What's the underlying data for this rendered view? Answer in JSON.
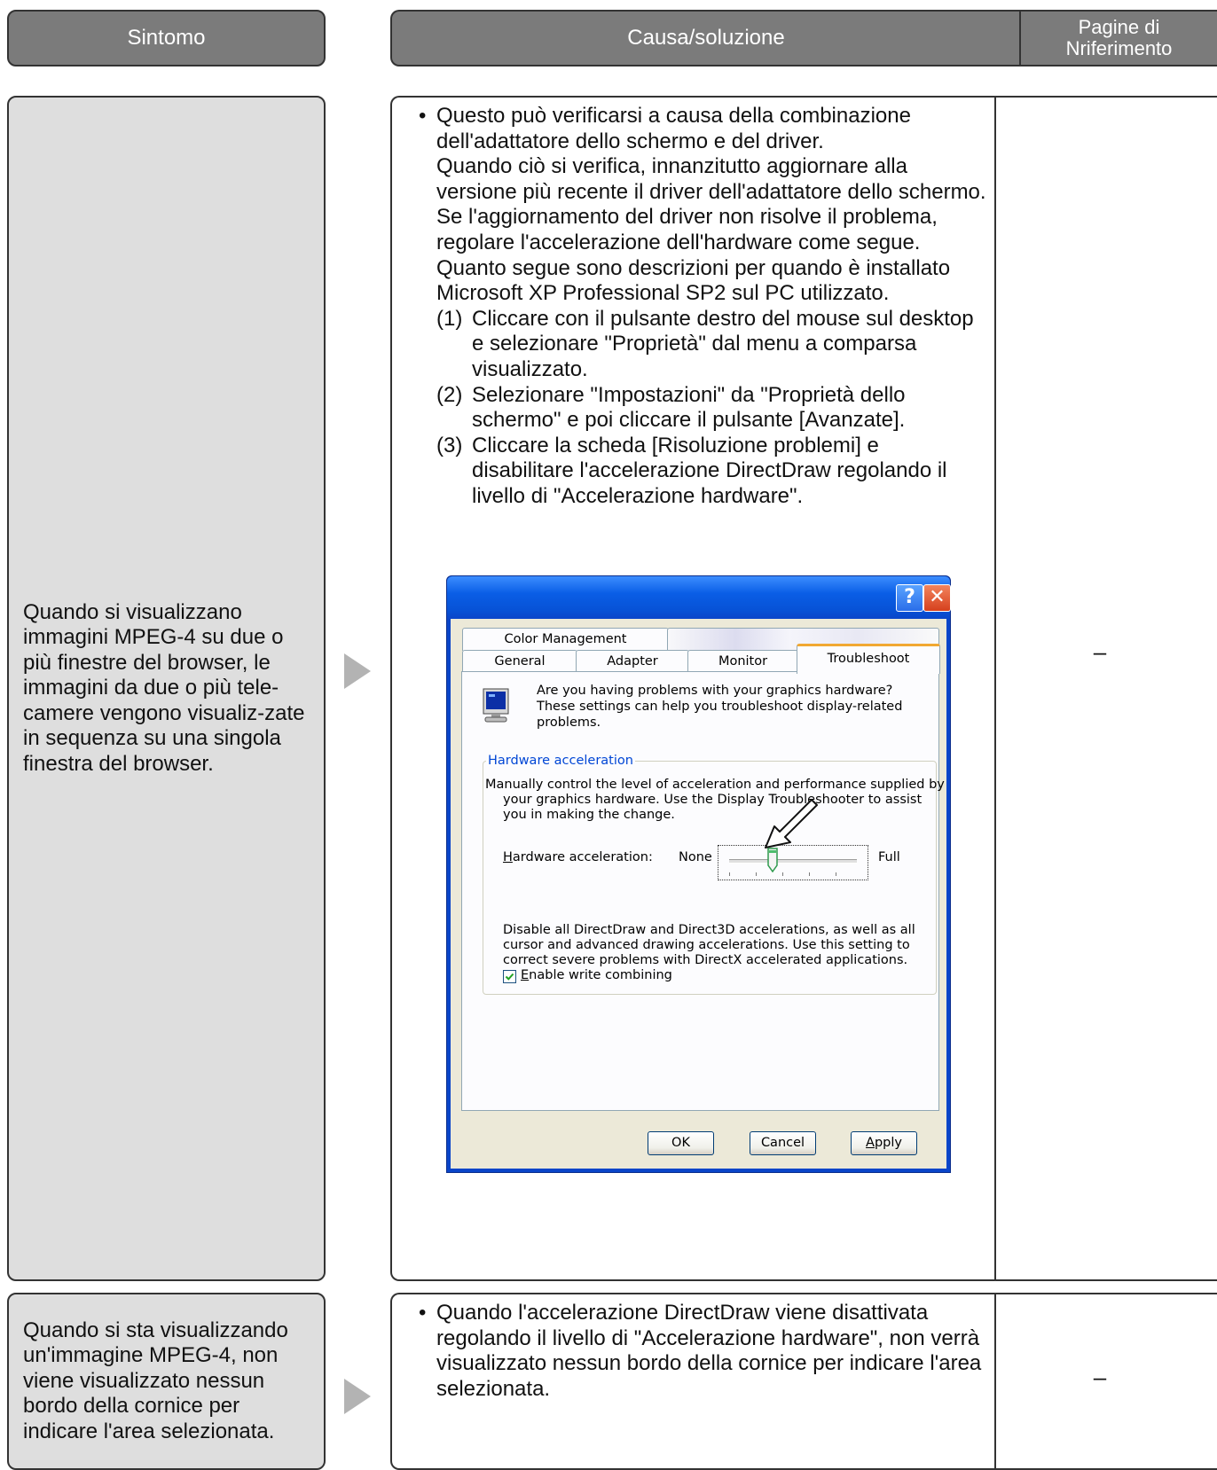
{
  "headers": {
    "symptom": "Sintomo",
    "cause": "Causa/soluzione",
    "ref_line1": "Pagine di",
    "ref_line2": "Nriferimento"
  },
  "row1": {
    "symptom": "Quando si visualizzano immagini MPEG-4 su due o più finestre del browser, le immagini da due o più tele-camere vengono visualiz-zate in sequenza su una singola finestra del browser.",
    "bullet": "•",
    "p1": "Questo può verificarsi a causa della combinazione dell'adattatore dello schermo e del driver.",
    "p2": "Quando ciò si verifica, innanzitutto aggiornare alla versione più recente il driver dell'adattatore dello schermo.",
    "p3": "Se l'aggiornamento del driver non risolve il problema, regolare l'accelerazione dell'hardware come segue.",
    "p4": "Quanto segue sono descrizioni per quando è installato Microsoft XP Professional SP2 sul PC utilizzato.",
    "steps": [
      {
        "num": "(1)",
        "text": "Cliccare con il pulsante destro del mouse sul desktop e selezionare \"Proprietà\" dal menu a comparsa visualizzato."
      },
      {
        "num": "(2)",
        "text": "Selezionare \"Impostazioni\" da \"Proprietà dello schermo\" e poi cliccare il pulsante [Avanzate]."
      },
      {
        "num": "(3)",
        "text": "Cliccare la scheda [Risoluzione problemi] e disabilitare l'accelerazione DirectDraw regolando il livello di \"Accelerazione hardware\"."
      }
    ],
    "ref": "–"
  },
  "dialog": {
    "help_glyph": "?",
    "close_glyph": "✕",
    "tabs_top": [
      "Color Management"
    ],
    "tabs_bottom": [
      "General",
      "Adapter",
      "Monitor",
      "Troubleshoot"
    ],
    "intro": "Are you having problems with your graphics hardware? These settings can help you troubleshoot display-related problems.",
    "group_title": "Hardware acceleration",
    "group_desc": "Manually control the level of acceleration and performance supplied by your graphics hardware. Use the Display Troubleshooter to assist you in making the change.",
    "slider_label_first": "H",
    "slider_label_rest": "ardware acceleration:",
    "slider_min": "None",
    "slider_max": "Full",
    "slider_level_fraction": 0.34,
    "level_desc": "Disable all DirectDraw and Direct3D accelerations, as well as all cursor and advanced drawing accelerations. Use this setting to correct severe problems with DirectX accelerated applications.",
    "checkbox_first": "E",
    "checkbox_rest": "nable write combining",
    "checkbox_checked": true,
    "buttons": {
      "ok": "OK",
      "cancel": "Cancel",
      "apply_first": "A",
      "apply_rest": "pply"
    },
    "colors": {
      "titlebar": "#0a5ee6",
      "client": "#ece9d8",
      "active_tab_accent": "#f1a832",
      "close": "#d6401d"
    }
  },
  "row2": {
    "symptom": "Quando si sta visualizzando un'immagine MPEG-4, non viene visualizzato nessun bordo della cornice per indicare l'area selezionata.",
    "bullet": "•",
    "text": "Quando l'accelerazione DirectDraw viene disattivata regolando il livello di \"Accelerazione hardware\", non verrà visualizzato nessun bordo della cornice per indicare l'area selezionata.",
    "ref": "–"
  }
}
